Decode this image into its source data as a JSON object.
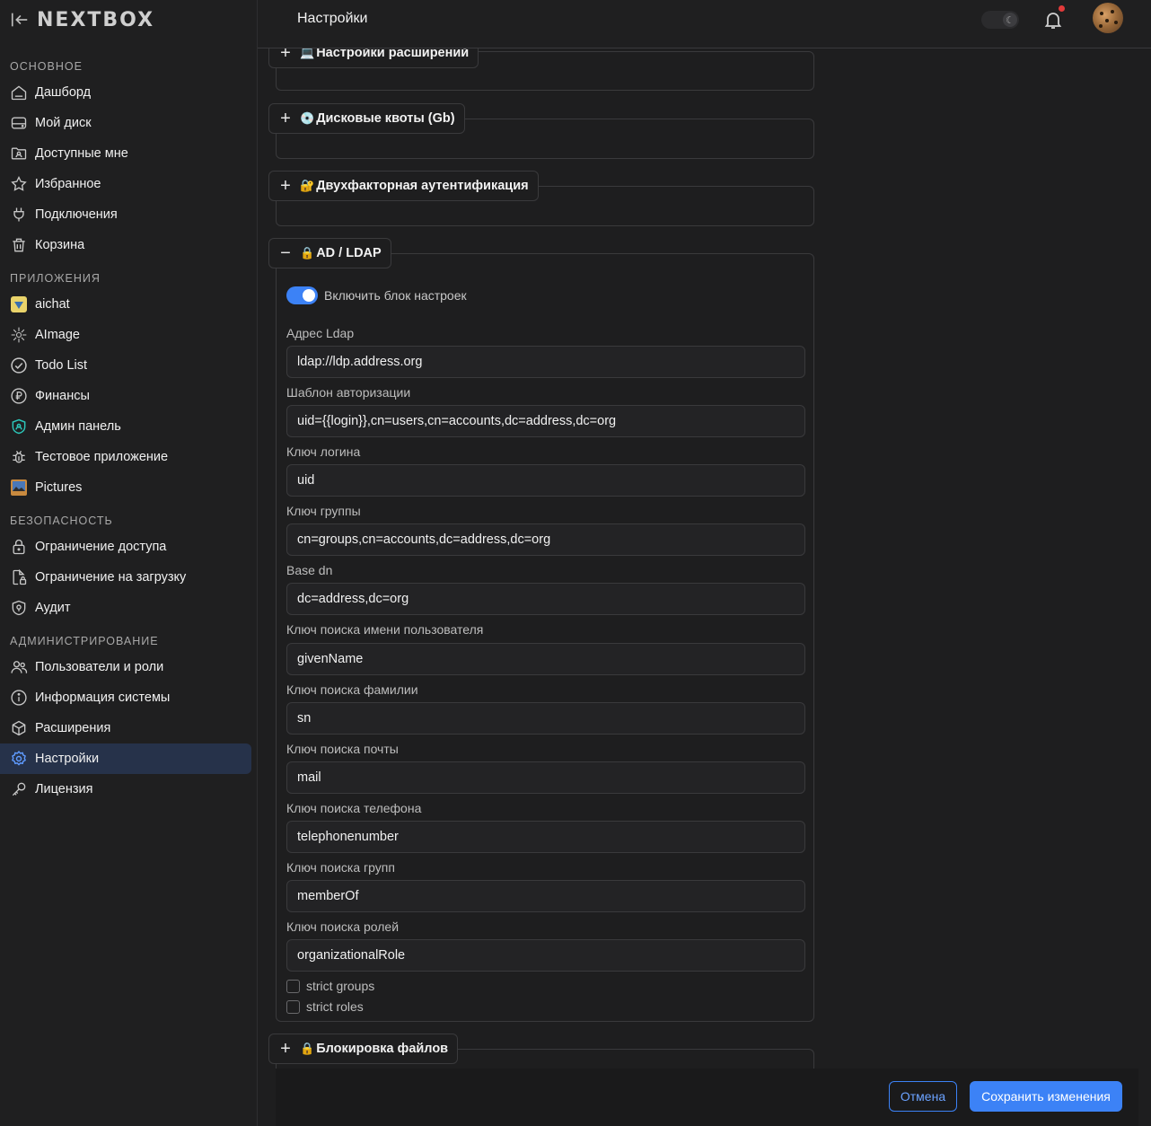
{
  "app": {
    "logo": "NEXTBOX"
  },
  "sidebar": {
    "sections": [
      {
        "title": "ОСНОВНОЕ",
        "items": [
          {
            "label": "Дашборд",
            "icon": "home-icon"
          },
          {
            "label": "Мой диск",
            "icon": "drive-icon"
          },
          {
            "label": "Доступные мне",
            "icon": "shared-folder-icon"
          },
          {
            "label": "Избранное",
            "icon": "star-icon"
          },
          {
            "label": "Подключения",
            "icon": "plug-icon"
          },
          {
            "label": "Корзина",
            "icon": "trash-icon"
          }
        ]
      },
      {
        "title": "ПРИЛОЖЕНИЯ",
        "items": [
          {
            "label": "aichat",
            "icon": "aichat-app-icon"
          },
          {
            "label": "AImage",
            "icon": "aimage-app-icon"
          },
          {
            "label": "Todo List",
            "icon": "check-circle-icon"
          },
          {
            "label": "Финансы",
            "icon": "ruble-icon"
          },
          {
            "label": "Админ панель",
            "icon": "admin-shield-icon"
          },
          {
            "label": "Тестовое приложение",
            "icon": "bug-icon"
          },
          {
            "label": "Pictures",
            "icon": "pictures-app-icon"
          }
        ]
      },
      {
        "title": "БЕЗОПАСНОСТЬ",
        "items": [
          {
            "label": "Ограничение доступа",
            "icon": "lock-icon"
          },
          {
            "label": "Ограничение на загрузку",
            "icon": "file-lock-icon"
          },
          {
            "label": "Аудит",
            "icon": "shield-icon"
          }
        ]
      },
      {
        "title": "АДМИНИСТРИРОВАНИЕ",
        "items": [
          {
            "label": "Пользователи и роли",
            "icon": "users-icon"
          },
          {
            "label": "Информация системы",
            "icon": "info-icon"
          },
          {
            "label": "Расширения",
            "icon": "package-icon"
          },
          {
            "label": "Настройки",
            "icon": "gear-icon",
            "active": true
          },
          {
            "label": "Лицензия",
            "icon": "key-icon"
          }
        ]
      }
    ]
  },
  "header": {
    "title": "Настройки"
  },
  "panels": {
    "extensions": {
      "title": "Настройки расширений",
      "emoji": "💻",
      "expanded": false
    },
    "quotas": {
      "title": "Дисковые квоты (Gb)",
      "emoji": "💿",
      "expanded": false
    },
    "twofa": {
      "title": "Двухфакторная аутентификация",
      "emoji": "🔐",
      "expanded": false
    },
    "ldap": {
      "title": "AD / LDAP",
      "emoji": "🔒",
      "expanded": true,
      "enable_label": "Включить блок настроек",
      "enabled": true,
      "fields": [
        {
          "label": "Адрес Ldap",
          "value": "ldap://ldp.address.org"
        },
        {
          "label": "Шаблон авторизации",
          "value": "uid={{login}},cn=users,cn=accounts,dc=address,dc=org"
        },
        {
          "label": "Ключ логина",
          "value": "uid"
        },
        {
          "label": "Ключ группы",
          "value": "cn=groups,cn=accounts,dc=address,dc=org"
        },
        {
          "label": "Base dn",
          "value": "dc=address,dc=org"
        },
        {
          "label": "Ключ поиска имени пользователя",
          "value": "givenName"
        },
        {
          "label": "Ключ поиска фамилии",
          "value": "sn"
        },
        {
          "label": "Ключ поиска почты",
          "value": "mail"
        },
        {
          "label": "Ключ поиска телефона",
          "value": "telephonenumber"
        },
        {
          "label": "Ключ поиска групп",
          "value": "memberOf"
        },
        {
          "label": "Ключ поиска ролей",
          "value": "organizationalRole"
        }
      ],
      "checkboxes": [
        {
          "label": "strict groups",
          "checked": false
        },
        {
          "label": "strict roles",
          "checked": false
        }
      ]
    },
    "filelock": {
      "title": "Блокировка файлов",
      "emoji": "🔒",
      "expanded": false
    }
  },
  "footer": {
    "cancel_label": "Отмена",
    "save_label": "Сохранить изменения"
  },
  "colors": {
    "accent": "#3c82f6",
    "active_nav_bg": "#26324a",
    "background": "#1e1e1f"
  }
}
